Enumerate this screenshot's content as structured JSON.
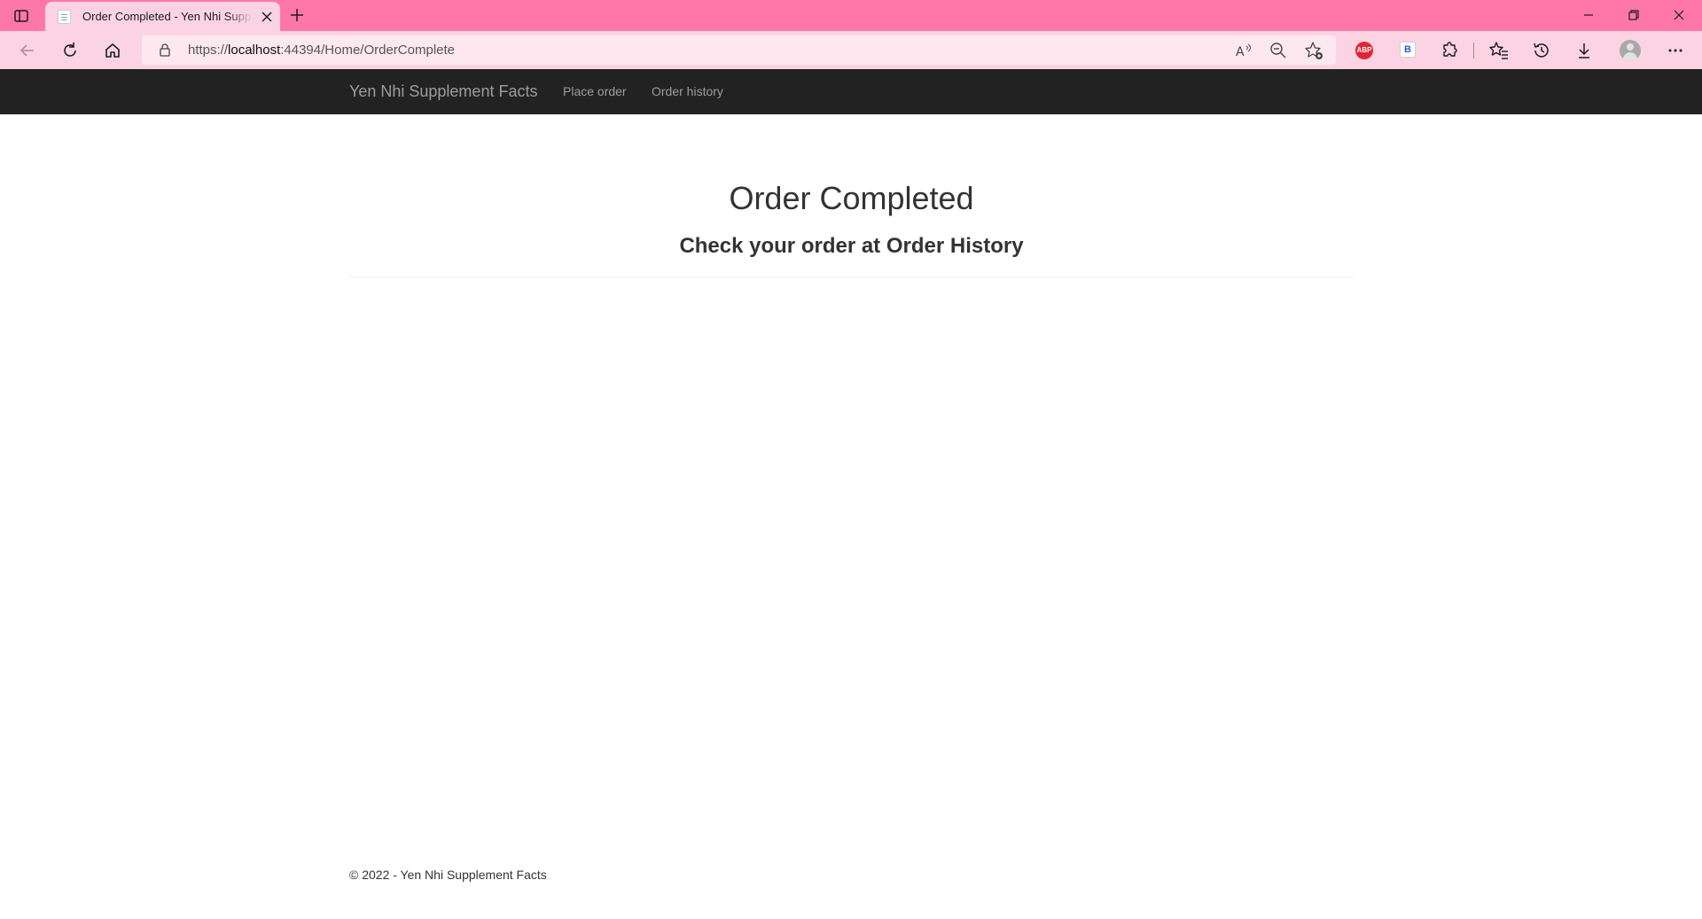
{
  "browser": {
    "tab_title": "Order Completed - Yen Nhi Supplement Facts",
    "url_scheme": "https://",
    "url_host": "localhost",
    "url_rest": ":44394/Home/OrderComplete",
    "extensions": {
      "abp_label": "ABP",
      "b_label": "B"
    }
  },
  "navbar": {
    "brand": "Yen Nhi Supplement Facts",
    "links": [
      "Place order",
      "Order history"
    ]
  },
  "main": {
    "heading": "Order Completed",
    "subheading_prefix": "Check your order at ",
    "subheading_link": "Order History"
  },
  "footer": {
    "text": "© 2022 - Yen Nhi Supplement Facts"
  },
  "colors": {
    "tabbar": "#ff77a6",
    "toolbar": "#fbd3e2",
    "navbar": "#222222",
    "nav_text": "#9d9d9d"
  }
}
